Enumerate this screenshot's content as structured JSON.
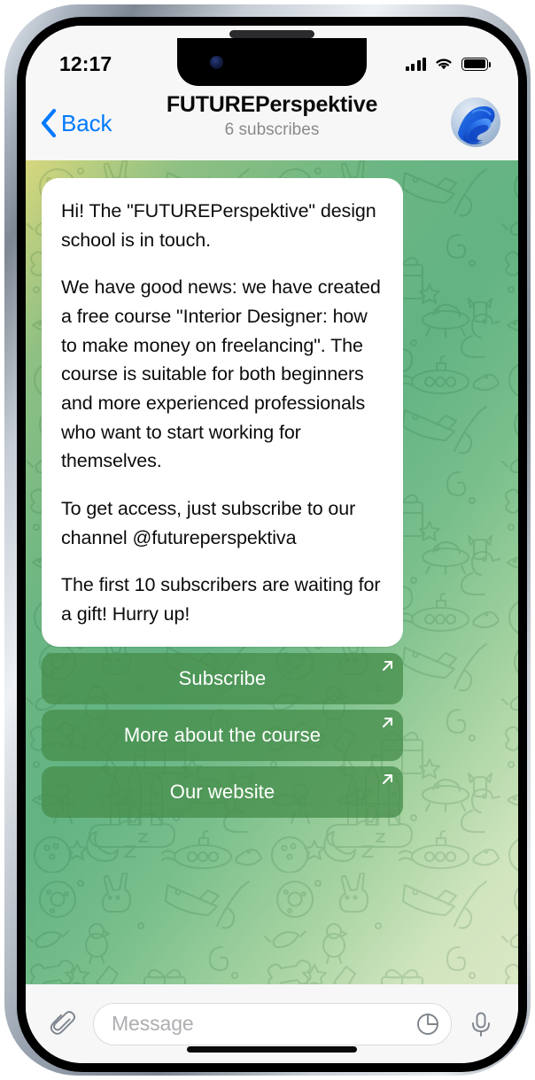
{
  "status_bar": {
    "time": "12:17",
    "signal_icon": "cellular-bars-icon",
    "wifi_icon": "wifi-icon",
    "battery_icon": "battery-full-icon"
  },
  "nav_bar": {
    "back_label": "Back",
    "back_icon": "chevron-left-icon",
    "title": "FUTUREPerspektive",
    "subtitle": "6 subscribes",
    "avatar_name": "channel-avatar"
  },
  "chat": {
    "message": {
      "paragraphs": [
        "Hi! The \"FUTUREPerspektive\" design school is in touch.",
        "We have good news: we have created a free course \"Interior Designer: how to make money on freelancing\". The course is suitable for both beginners and more experienced professionals who want to start working for themselves.",
        "To get access, just subscribe to our channel @futureperspektiva",
        "The first 10 subscribers are waiting for a gift! Hurry up!"
      ]
    },
    "inline_buttons": [
      {
        "label": "Subscribe",
        "icon": "external-link-arrow-icon"
      },
      {
        "label": "More about the course",
        "icon": "external-link-arrow-icon"
      },
      {
        "label": "Our website",
        "icon": "external-link-arrow-icon"
      }
    ]
  },
  "input_bar": {
    "attach_icon": "paperclip-icon",
    "placeholder": "Message",
    "value": "",
    "sticker_icon": "sticker-icon",
    "mic_icon": "microphone-icon"
  },
  "colors": {
    "accent_blue": "#007AFF",
    "button_green": "#468E4C",
    "bubble_white": "#FFFFFF",
    "bar_background": "#F7F7F7",
    "subtitle_gray": "#8A8A8E",
    "placeholder_gray": "#AEAEB2"
  }
}
